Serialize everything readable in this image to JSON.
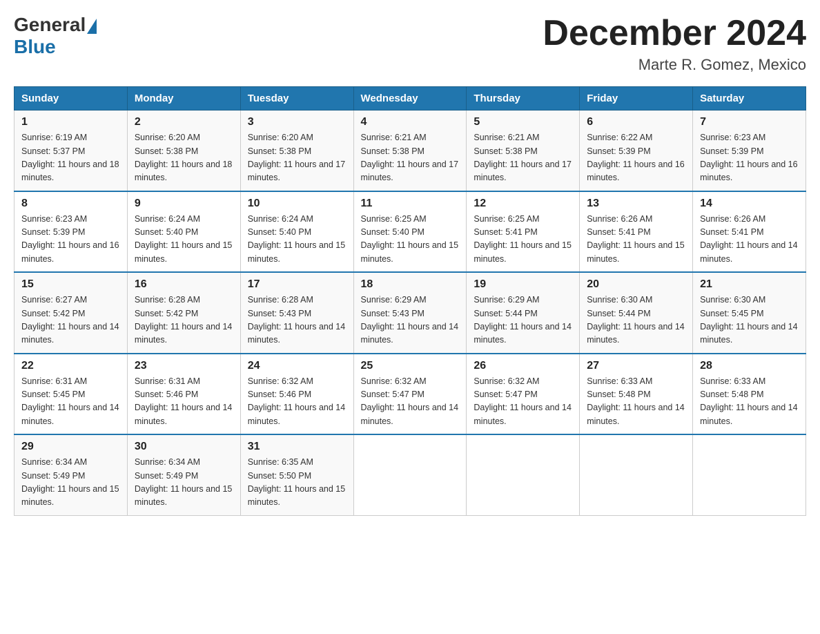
{
  "header": {
    "logo_general": "General",
    "logo_blue": "Blue",
    "month_title": "December 2024",
    "location": "Marte R. Gomez, Mexico"
  },
  "weekdays": [
    "Sunday",
    "Monday",
    "Tuesday",
    "Wednesday",
    "Thursday",
    "Friday",
    "Saturday"
  ],
  "weeks": [
    [
      {
        "day": "1",
        "sunrise": "6:19 AM",
        "sunset": "5:37 PM",
        "daylight": "11 hours and 18 minutes."
      },
      {
        "day": "2",
        "sunrise": "6:20 AM",
        "sunset": "5:38 PM",
        "daylight": "11 hours and 18 minutes."
      },
      {
        "day": "3",
        "sunrise": "6:20 AM",
        "sunset": "5:38 PM",
        "daylight": "11 hours and 17 minutes."
      },
      {
        "day": "4",
        "sunrise": "6:21 AM",
        "sunset": "5:38 PM",
        "daylight": "11 hours and 17 minutes."
      },
      {
        "day": "5",
        "sunrise": "6:21 AM",
        "sunset": "5:38 PM",
        "daylight": "11 hours and 17 minutes."
      },
      {
        "day": "6",
        "sunrise": "6:22 AM",
        "sunset": "5:39 PM",
        "daylight": "11 hours and 16 minutes."
      },
      {
        "day": "7",
        "sunrise": "6:23 AM",
        "sunset": "5:39 PM",
        "daylight": "11 hours and 16 minutes."
      }
    ],
    [
      {
        "day": "8",
        "sunrise": "6:23 AM",
        "sunset": "5:39 PM",
        "daylight": "11 hours and 16 minutes."
      },
      {
        "day": "9",
        "sunrise": "6:24 AM",
        "sunset": "5:40 PM",
        "daylight": "11 hours and 15 minutes."
      },
      {
        "day": "10",
        "sunrise": "6:24 AM",
        "sunset": "5:40 PM",
        "daylight": "11 hours and 15 minutes."
      },
      {
        "day": "11",
        "sunrise": "6:25 AM",
        "sunset": "5:40 PM",
        "daylight": "11 hours and 15 minutes."
      },
      {
        "day": "12",
        "sunrise": "6:25 AM",
        "sunset": "5:41 PM",
        "daylight": "11 hours and 15 minutes."
      },
      {
        "day": "13",
        "sunrise": "6:26 AM",
        "sunset": "5:41 PM",
        "daylight": "11 hours and 15 minutes."
      },
      {
        "day": "14",
        "sunrise": "6:26 AM",
        "sunset": "5:41 PM",
        "daylight": "11 hours and 14 minutes."
      }
    ],
    [
      {
        "day": "15",
        "sunrise": "6:27 AM",
        "sunset": "5:42 PM",
        "daylight": "11 hours and 14 minutes."
      },
      {
        "day": "16",
        "sunrise": "6:28 AM",
        "sunset": "5:42 PM",
        "daylight": "11 hours and 14 minutes."
      },
      {
        "day": "17",
        "sunrise": "6:28 AM",
        "sunset": "5:43 PM",
        "daylight": "11 hours and 14 minutes."
      },
      {
        "day": "18",
        "sunrise": "6:29 AM",
        "sunset": "5:43 PM",
        "daylight": "11 hours and 14 minutes."
      },
      {
        "day": "19",
        "sunrise": "6:29 AM",
        "sunset": "5:44 PM",
        "daylight": "11 hours and 14 minutes."
      },
      {
        "day": "20",
        "sunrise": "6:30 AM",
        "sunset": "5:44 PM",
        "daylight": "11 hours and 14 minutes."
      },
      {
        "day": "21",
        "sunrise": "6:30 AM",
        "sunset": "5:45 PM",
        "daylight": "11 hours and 14 minutes."
      }
    ],
    [
      {
        "day": "22",
        "sunrise": "6:31 AM",
        "sunset": "5:45 PM",
        "daylight": "11 hours and 14 minutes."
      },
      {
        "day": "23",
        "sunrise": "6:31 AM",
        "sunset": "5:46 PM",
        "daylight": "11 hours and 14 minutes."
      },
      {
        "day": "24",
        "sunrise": "6:32 AM",
        "sunset": "5:46 PM",
        "daylight": "11 hours and 14 minutes."
      },
      {
        "day": "25",
        "sunrise": "6:32 AM",
        "sunset": "5:47 PM",
        "daylight": "11 hours and 14 minutes."
      },
      {
        "day": "26",
        "sunrise": "6:32 AM",
        "sunset": "5:47 PM",
        "daylight": "11 hours and 14 minutes."
      },
      {
        "day": "27",
        "sunrise": "6:33 AM",
        "sunset": "5:48 PM",
        "daylight": "11 hours and 14 minutes."
      },
      {
        "day": "28",
        "sunrise": "6:33 AM",
        "sunset": "5:48 PM",
        "daylight": "11 hours and 14 minutes."
      }
    ],
    [
      {
        "day": "29",
        "sunrise": "6:34 AM",
        "sunset": "5:49 PM",
        "daylight": "11 hours and 15 minutes."
      },
      {
        "day": "30",
        "sunrise": "6:34 AM",
        "sunset": "5:49 PM",
        "daylight": "11 hours and 15 minutes."
      },
      {
        "day": "31",
        "sunrise": "6:35 AM",
        "sunset": "5:50 PM",
        "daylight": "11 hours and 15 minutes."
      },
      null,
      null,
      null,
      null
    ]
  ]
}
